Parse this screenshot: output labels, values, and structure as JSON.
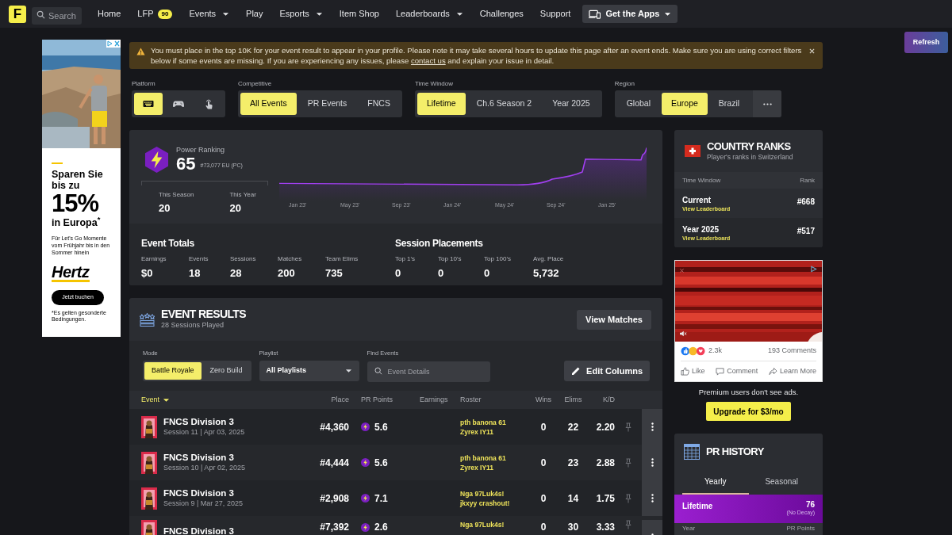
{
  "nav": {
    "logo": "F",
    "search": {
      "placeholder": "Search"
    },
    "items": [
      {
        "label": "Home",
        "dropdown": false
      },
      {
        "label": "LFP",
        "badge": "90",
        "dropdown": false
      },
      {
        "label": "Events",
        "dropdown": true
      },
      {
        "label": "Play",
        "dropdown": false
      },
      {
        "label": "Esports",
        "dropdown": true
      },
      {
        "label": "Item Shop",
        "dropdown": false
      },
      {
        "label": "Leaderboards",
        "dropdown": true
      },
      {
        "label": "Challenges",
        "dropdown": false
      },
      {
        "label": "Support",
        "dropdown": false
      }
    ],
    "apps_button": {
      "label": "Get the Apps",
      "dropdown": true
    }
  },
  "refresh_button": "Refresh",
  "side_ad": {
    "kind": "picture",
    "headline": "Sparen Sie bis zu",
    "big": "15%",
    "subline": "in Europa$^{*}$",
    "body": "Für Let's Go Momente vom Frühjahr bis in den Sommer hinein",
    "brand": "Hertz",
    "button": "Jetzt buchen",
    "footnote": "*Es gelten gesonderte Bedingungen."
  },
  "notice": {
    "text": "You must place in the top 10K for your event result to appear in your profile. Please note it may take several hours to update this page after an event ends. Make sure you are using correct filters below if some events are missing. If you are experiencing any issues, please",
    "link": "contact us",
    "text_after": "and explain your issue in detail.",
    "closable": true
  },
  "filters": [
    {
      "label": "Platform",
      "options": [
        {
          "kind": "icon",
          "selected": true
        },
        {
          "kind": "icon",
          "selected": false
        },
        {
          "kind": "icon",
          "selected": false
        }
      ]
    },
    {
      "label": "Competitive",
      "options": [
        {
          "kind": "text",
          "label": "All Events",
          "selected": true
        },
        {
          "kind": "text",
          "label": "PR Events",
          "selected": false
        },
        {
          "kind": "text",
          "label": "FNCS",
          "selected": false
        }
      ]
    },
    {
      "label": "Time Window",
      "options": [
        {
          "kind": "text",
          "label": "Lifetime",
          "selected": true
        },
        {
          "kind": "text",
          "label": "Ch.6 Season 2",
          "selected": false
        },
        {
          "kind": "text",
          "label": "Year 2025",
          "selected": false
        }
      ]
    },
    {
      "label": "Region",
      "options": [
        {
          "kind": "text",
          "label": "Global",
          "selected": false
        },
        {
          "kind": "text",
          "label": "Europe",
          "selected": true
        },
        {
          "kind": "text",
          "label": "Brazil",
          "selected": false
        },
        {
          "kind": "more",
          "selected": false
        }
      ]
    }
  ],
  "power_ranking": {
    "title": "Power Ranking",
    "value": "65",
    "rank_note": "#73,077 EU (PC)",
    "stats": [
      {
        "label": "This Season",
        "value": "20"
      },
      {
        "label": "This Year",
        "value": "20"
      }
    ],
    "axis_labels": [
      "Jan 23'",
      "May 23'",
      "Sep 23'",
      "Jan 24'",
      "May 24'",
      "Sep 24'",
      "Jan 25'"
    ]
  },
  "event_totals": {
    "title": "Event Totals",
    "stats": [
      {
        "label": "Earnings",
        "value": "$0"
      },
      {
        "label": "Events",
        "value": "18"
      },
      {
        "label": "Sessions",
        "value": "28"
      },
      {
        "label": "Matches",
        "value": "200"
      },
      {
        "label": "Team Elims",
        "value": "735"
      }
    ]
  },
  "session_placements": {
    "title": "Session Placements",
    "stats": [
      {
        "label": "Top 1's",
        "value": "0"
      },
      {
        "label": "Top 10's",
        "value": "0"
      },
      {
        "label": "Top 100's",
        "value": "0"
      },
      {
        "label": "Avg. Place",
        "value": "5,732"
      }
    ]
  },
  "event_results": {
    "title": "EVENT RESULTS",
    "subtitle": "28 Sessions Played",
    "view_matches_button": "View Matches",
    "mode": {
      "label": "Mode",
      "options": [
        {
          "label": "Battle Royale",
          "selected": true
        },
        {
          "label": "Zero Build",
          "selected": false
        }
      ]
    },
    "playlist": {
      "label": "Playlist",
      "value": "All Playlists"
    },
    "find": {
      "label": "Find Events",
      "placeholder": "Event Details"
    },
    "edit_columns_button": "Edit Columns",
    "columns": [
      {
        "label": "Event",
        "sorted": true
      },
      {
        "label": "Place",
        "sorted": false
      },
      {
        "label": "PR Points",
        "sorted": false
      },
      {
        "label": "Earnings",
        "sorted": false
      },
      {
        "label": "Roster",
        "sorted": false
      },
      {
        "label": "Wins",
        "sorted": false
      },
      {
        "label": "Elims",
        "sorted": false
      },
      {
        "label": "K/D",
        "sorted": false
      }
    ],
    "rows": [
      {
        "event": "FNCS Division 3",
        "session": "Session 11 | Apr 03, 2025",
        "place": "#4,360",
        "pr_points": "5.6",
        "roster": [
          "pth banona 61",
          "Zyrex IY11"
        ],
        "wins": "0",
        "elims": "22",
        "kd": "2.20"
      },
      {
        "event": "FNCS Division 3",
        "session": "Session 10 | Apr 02, 2025",
        "place": "#4,444",
        "pr_points": "5.6",
        "roster": [
          "pth banona 61",
          "Zyrex IY11"
        ],
        "wins": "0",
        "elims": "23",
        "kd": "2.88"
      },
      {
        "event": "FNCS Division 3",
        "session": "Session 9 | Mar 27, 2025",
        "place": "#2,908",
        "pr_points": "7.1",
        "roster": [
          "Nga 97Luk4s!",
          "jkxyy crashout!"
        ],
        "wins": "0",
        "elims": "14",
        "kd": "1.75"
      },
      {
        "event": "FNCS Division 3",
        "place": "#7,392",
        "pr_points": "2.6",
        "roster": [
          "Nga 97Luk4s!"
        ],
        "wins": "0",
        "elims": "30",
        "kd": "3.33"
      }
    ]
  },
  "country_ranks": {
    "title": "COUNTRY RANKS",
    "subtitle": "Player's ranks in Switzerland",
    "columns": [
      "Time Window",
      "Rank"
    ],
    "rows": [
      {
        "window": "Current",
        "link": "View Leaderboard",
        "rank": "#668"
      },
      {
        "window": "Year 2025",
        "link": "View Leaderboard",
        "rank": "#517"
      }
    ]
  },
  "video_ad": {
    "kind": "picture",
    "reaction_count": "2.3k",
    "comments": "193 Comments",
    "actions": [
      "Like",
      "Comment",
      "Learn More"
    ]
  },
  "premium": {
    "note": "Premium users don't see ads.",
    "button": "Upgrade for $3/mo"
  },
  "pr_history": {
    "title": "PR HISTORY",
    "tabs": [
      {
        "label": "Yearly",
        "selected": true
      },
      {
        "label": "Seasonal",
        "selected": false
      }
    ],
    "lifetime": {
      "label": "Lifetime",
      "value": "76",
      "note": "(No Decay)"
    },
    "columns": [
      "Year",
      "PR Points"
    ]
  }
}
